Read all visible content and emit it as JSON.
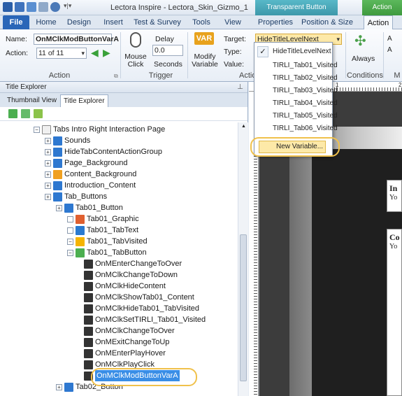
{
  "window": {
    "title": "Lectora Inspire - Lectora_Skin_Gizmo_1"
  },
  "context_tabs": {
    "transparent_button": "Transparent Button",
    "action": "Action"
  },
  "tabs": [
    "File",
    "Home",
    "Design",
    "Insert",
    "Test & Survey",
    "Tools",
    "View",
    "Properties",
    "Position & Size",
    "Action"
  ],
  "ribbon": {
    "name_label": "Name:",
    "name_value": "OnMClkModButtonVarA",
    "action_label": "Action:",
    "action_value": "11 of 11",
    "action_group": "Action",
    "mouse_click": "Mouse Click",
    "delay_label": "Delay",
    "delay_value": "0.0",
    "seconds": "Seconds",
    "trigger_group": "Trigger",
    "modify_variable": "Modify Variable",
    "var_icon_text": "VAR",
    "target_label": "Target:",
    "type_label": "Type:",
    "value_label": "Value:",
    "target_value": "HideTitleLevelNext",
    "action_group2": "Action",
    "always": "Always",
    "conditions_group": "Conditions",
    "m_group": "M",
    "a1": "A",
    "a2": "A"
  },
  "dropdown": {
    "items": [
      "HideTitleLevelNext",
      "TIRLI_Tab01_Visited",
      "TIRLI_Tab02_Visited",
      "TIRLI_Tab03_Visited",
      "TIRLI_Tab04_Visited",
      "TIRLI_Tab05_Visited",
      "TIRLI_Tab06_Visited"
    ],
    "new_variable": "New Variable..."
  },
  "panel": {
    "title": "Title Explorer",
    "tabs": [
      "Thumbnail View",
      "Title Explorer"
    ],
    "tree": [
      {
        "label": "Tabs Intro Right Interaction Page",
        "depth": 2,
        "icon": "page-icon"
      },
      {
        "label": "Sounds",
        "depth": 3,
        "icon": "group-icon"
      },
      {
        "label": "HideTabContentActionGroup",
        "depth": 3,
        "icon": "group-icon"
      },
      {
        "label": "Page_Background",
        "depth": 3,
        "icon": "group-icon"
      },
      {
        "label": "Content_Background",
        "depth": 3,
        "icon": "shape-icon"
      },
      {
        "label": "Introduction_Content",
        "depth": 3,
        "icon": "group-icon"
      },
      {
        "label": "Tab_Buttons",
        "depth": 3,
        "icon": "group-icon"
      },
      {
        "label": "Tab01_Button",
        "depth": 4,
        "icon": "group-icon"
      },
      {
        "label": "Tab01_Graphic",
        "depth": 5,
        "icon": "image-icon"
      },
      {
        "label": "Tab01_TabText",
        "depth": 5,
        "icon": "text-icon"
      },
      {
        "label": "Tab01_TabVisited",
        "depth": 5,
        "icon": "gif-icon"
      },
      {
        "label": "Tab01_TabButton",
        "depth": 5,
        "icon": "button-icon"
      },
      {
        "label": "OnMEnterChangeToOver",
        "depth": 6,
        "icon": "action-icon"
      },
      {
        "label": "OnMClkChangeToDown",
        "depth": 6,
        "icon": "action-icon"
      },
      {
        "label": "OnMClkHideContent",
        "depth": 6,
        "icon": "action-icon"
      },
      {
        "label": "OnMClkShowTab01_Content",
        "depth": 6,
        "icon": "action-icon"
      },
      {
        "label": "OnMClkHideTab01_TabVisited",
        "depth": 6,
        "icon": "action-icon"
      },
      {
        "label": "OnMClkSetTIRLI_Tab01_Visited",
        "depth": 6,
        "icon": "action-icon"
      },
      {
        "label": "OnMClkChangeToOver",
        "depth": 6,
        "icon": "action-icon"
      },
      {
        "label": "OnMExitChangeToUp",
        "depth": 6,
        "icon": "action-icon"
      },
      {
        "label": "OnMEnterPlayHover",
        "depth": 6,
        "icon": "action-icon"
      },
      {
        "label": "OnMClkPlayClick",
        "depth": 6,
        "icon": "action-icon"
      },
      {
        "label": "OnMClkModButtonVarA",
        "depth": 6,
        "icon": "action-icon",
        "selected": true
      },
      {
        "label": "Tab02_Button",
        "depth": 4,
        "icon": "group-icon"
      }
    ]
  },
  "canvas": {
    "heading1": "In",
    "text1": "Yo",
    "heading2": "Co",
    "text2": "Yo",
    "ruler_marks": [
      "1",
      "2"
    ]
  }
}
